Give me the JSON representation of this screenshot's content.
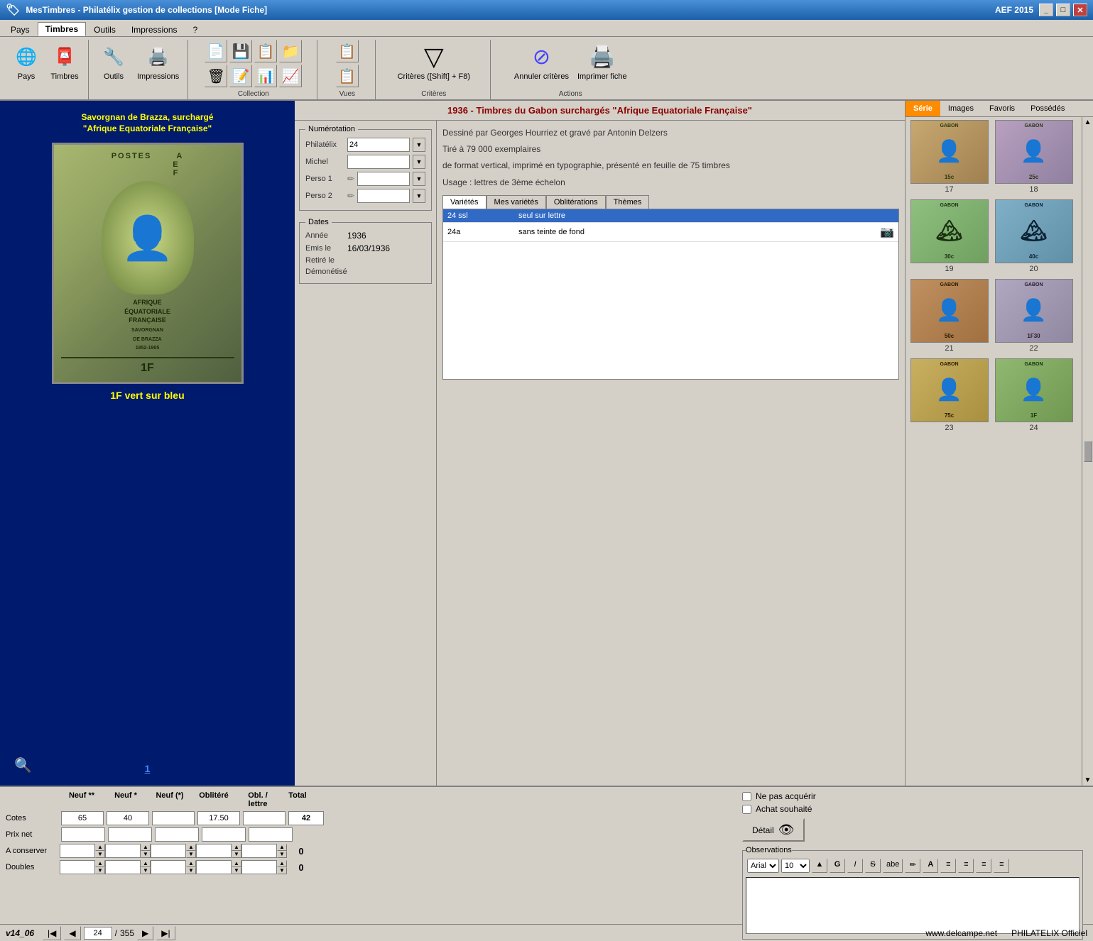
{
  "titlebar": {
    "title": "MesTimbres - Philatélix gestion de collections [Mode Fiche]",
    "version": "AEF 2015",
    "controls": [
      "minimize",
      "maximize",
      "close"
    ]
  },
  "menubar": {
    "tabs": [
      "Pays",
      "Timbres",
      "Outils",
      "Impressions",
      "?"
    ],
    "active": "Timbres"
  },
  "toolbar": {
    "groups": [
      {
        "label": "Pays",
        "buttons": [
          {
            "label": "Pays",
            "icon": "🌐"
          },
          {
            "label": "Timbres",
            "icon": "📮"
          }
        ]
      },
      {
        "label": "",
        "buttons": [
          {
            "label": "Outils",
            "icon": "🔧"
          },
          {
            "label": "Impressions",
            "icon": "🖨️"
          }
        ]
      },
      {
        "label": "Collection",
        "buttons": []
      },
      {
        "label": "Vues",
        "buttons": []
      },
      {
        "label": "Critères",
        "buttons": [
          {
            "label": "Critères ([Shift] + F8)",
            "icon": "▼"
          }
        ]
      },
      {
        "label": "Actions",
        "buttons": [
          {
            "label": "Annuler critères",
            "icon": "✕"
          },
          {
            "label": "Imprimer fiche",
            "icon": "🖨️"
          }
        ]
      }
    ]
  },
  "series_title": "1936 - Timbres du Gabon surchargés \"Afrique Equatoriale Française\"",
  "stamp_panel": {
    "title_line1": "Savorgnan de Brazza, surchargé",
    "title_line2": "\"Afrique Equatoriale Française\"",
    "caption": "1F vert sur bleu",
    "nav_number": "1"
  },
  "numbering": {
    "legend": "Numérotation",
    "fields": [
      {
        "label": "Philatélix",
        "value": "24"
      },
      {
        "label": "Michel",
        "value": ""
      },
      {
        "label": "Perso 1",
        "value": ""
      },
      {
        "label": "Perso 2",
        "value": ""
      }
    ]
  },
  "dates": {
    "legend": "Dates",
    "fields": [
      {
        "label": "Année",
        "value": "1936"
      },
      {
        "label": "Emis le",
        "value": "16/03/1936"
      },
      {
        "label": "Retiré le",
        "value": ""
      },
      {
        "label": "Démonétisé",
        "value": ""
      }
    ]
  },
  "info": {
    "designer": "Dessiné par Georges Hourriez et gravé par Antonin Delzers",
    "tirage": "Tiré à 79 000 exemplaires",
    "format": "de format vertical, imprimé en typographie, présenté en feuille de 75 timbres",
    "usage": "Usage : lettres de 3ème échelon"
  },
  "varieties_tabs": [
    "Variétés",
    "Mes variétés",
    "Oblitérations",
    "Thèmes"
  ],
  "varieties_active": "Variétés",
  "varieties": [
    {
      "code": "24 ssl",
      "desc": "seul sur lettre",
      "has_img": false,
      "selected": true
    },
    {
      "code": "24a",
      "desc": "sans teinte de fond",
      "has_img": true,
      "selected": false
    }
  ],
  "series_tabs": [
    "Série",
    "Images",
    "Favoris",
    "Possédés"
  ],
  "series_active": "Série",
  "thumbnails": [
    {
      "num": "17",
      "class": "stamp-17"
    },
    {
      "num": "18",
      "class": "stamp-18"
    },
    {
      "num": "19",
      "class": "stamp-19"
    },
    {
      "num": "20",
      "class": "stamp-20"
    },
    {
      "num": "21",
      "class": "stamp-21"
    },
    {
      "num": "22",
      "class": "stamp-22"
    },
    {
      "num": "23",
      "class": "stamp-23"
    },
    {
      "num": "24",
      "class": "stamp-24"
    }
  ],
  "prices": {
    "headers": [
      "",
      "Neuf **",
      "Neuf *",
      "Neuf (*)",
      "Oblitéré",
      "Obl. / lettre",
      "Total"
    ],
    "rows": [
      {
        "label": "Cotes",
        "values": [
          "65",
          "40",
          "",
          "17.50",
          "",
          "42"
        ],
        "total": ""
      },
      {
        "label": "Prix net",
        "values": [
          "",
          "",
          "",
          "",
          "",
          ""
        ],
        "total": ""
      },
      {
        "label": "A conserver",
        "values": [
          "",
          "",
          "",
          "",
          "",
          ""
        ],
        "total": "0"
      },
      {
        "label": "Doubles",
        "values": [
          "",
          "",
          "",
          "",
          "",
          ""
        ],
        "total": "0"
      }
    ]
  },
  "checkboxes": [
    {
      "label": "Ne pas acquérir",
      "checked": false
    },
    {
      "label": "Achat souhaité",
      "checked": false
    }
  ],
  "detail_btn": "Détail",
  "observations_label": "Observations",
  "obs_toolbar_buttons": [
    "▼",
    "▼",
    "▲▼",
    "G",
    "I",
    "S̲",
    "abe",
    "✏",
    "A",
    "≡",
    "≡",
    "≡",
    "≡"
  ],
  "statusbar": {
    "version": "v14_06",
    "current": "24",
    "total": "355",
    "website": "www.delcampe.net",
    "official": "PHILATELIX Officiel"
  }
}
